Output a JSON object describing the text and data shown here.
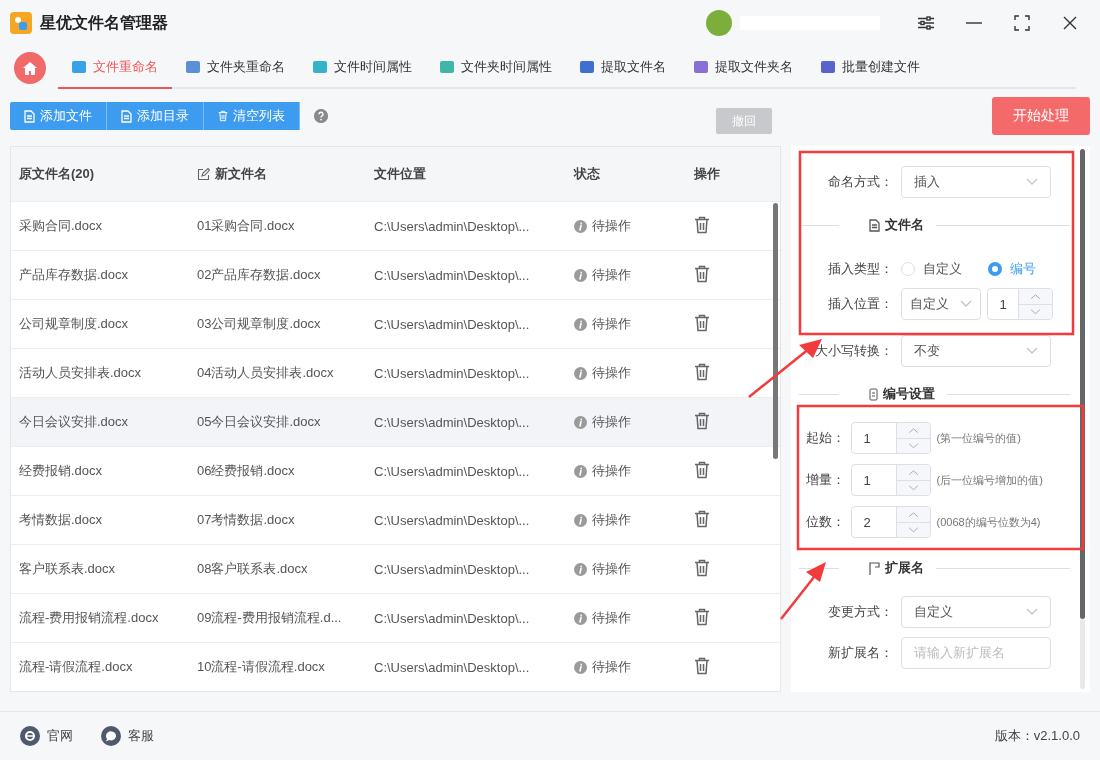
{
  "app": {
    "title": "星优文件名管理器"
  },
  "tabs": [
    {
      "label": "文件重命名",
      "selected": true,
      "color": "#3aa0e8"
    },
    {
      "label": "文件夹重命名",
      "selected": false,
      "color": "#5b8fd6"
    },
    {
      "label": "文件时间属性",
      "selected": false,
      "color": "#36b3c9"
    },
    {
      "label": "文件夹时间属性",
      "selected": false,
      "color": "#40b6a8"
    },
    {
      "label": "提取文件名",
      "selected": false,
      "color": "#3f6fd0"
    },
    {
      "label": "提取文件夹名",
      "selected": false,
      "color": "#8a6fd8"
    },
    {
      "label": "批量创建文件",
      "selected": false,
      "color": "#5a63c9"
    }
  ],
  "toolbar": {
    "buttons": [
      {
        "label": "添加文件",
        "kind": "doc"
      },
      {
        "label": "添加目录",
        "kind": "doc"
      },
      {
        "label": "清空列表",
        "kind": "trash"
      }
    ],
    "undo": {
      "label": "撤回",
      "disabled": true
    },
    "start": "开始处理"
  },
  "table": {
    "columns": [
      "原文件名(20)",
      "新文件名",
      "文件位置",
      "状态",
      "操作"
    ],
    "rows": [
      {
        "original": "采购合同.docx",
        "renamed": "01采购合同.docx",
        "location": "C:\\Users\\admin\\Desktop\\...",
        "status": "待操作",
        "selected": false
      },
      {
        "original": "产品库存数据.docx",
        "renamed": "02产品库存数据.docx",
        "location": "C:\\Users\\admin\\Desktop\\...",
        "status": "待操作",
        "selected": false
      },
      {
        "original": "公司规章制度.docx",
        "renamed": "03公司规章制度.docx",
        "location": "C:\\Users\\admin\\Desktop\\...",
        "status": "待操作",
        "selected": false
      },
      {
        "original": "活动人员安排表.docx",
        "renamed": "04活动人员安排表.docx",
        "location": "C:\\Users\\admin\\Desktop\\...",
        "status": "待操作",
        "selected": false
      },
      {
        "original": "今日会议安排.docx",
        "renamed": "05今日会议安排.docx",
        "location": "C:\\Users\\admin\\Desktop\\...",
        "status": "待操作",
        "selected": true
      },
      {
        "original": "经费报销.docx",
        "renamed": "06经费报销.docx",
        "location": "C:\\Users\\admin\\Desktop\\...",
        "status": "待操作",
        "selected": false
      },
      {
        "original": "考情数据.docx",
        "renamed": "07考情数据.docx",
        "location": "C:\\Users\\admin\\Desktop\\...",
        "status": "待操作",
        "selected": false
      },
      {
        "original": "客户联系表.docx",
        "renamed": "08客户联系表.docx",
        "location": "C:\\Users\\admin\\Desktop\\...",
        "status": "待操作",
        "selected": false
      },
      {
        "original": "流程-费用报销流程.docx",
        "renamed": "09流程-费用报销流程.d...",
        "location": "C:\\Users\\admin\\Desktop\\...",
        "status": "待操作",
        "selected": false
      },
      {
        "original": "流程-请假流程.docx",
        "renamed": "10流程-请假流程.docx",
        "location": "C:\\Users\\admin\\Desktop\\...",
        "status": "待操作",
        "selected": false
      }
    ]
  },
  "panel": {
    "naming": {
      "label": "命名方式：",
      "value": "插入"
    },
    "filename_section": "文件名",
    "insert_type": {
      "label": "插入类型：",
      "options": [
        {
          "label": "自定义",
          "selected": false
        },
        {
          "label": "编号",
          "selected": true
        }
      ]
    },
    "insert_position": {
      "label": "插入位置：",
      "mode": "自定义",
      "value": "1"
    },
    "case": {
      "label": "大小写转换：",
      "value": "不变"
    },
    "numbering_section": "编号设置",
    "numbering": [
      {
        "label": "起始：",
        "value": "1",
        "hint": "(第一位编号的值)"
      },
      {
        "label": "增量：",
        "value": "1",
        "hint": "(后一位编号增加的值)"
      },
      {
        "label": "位数：",
        "value": "2",
        "hint": "(0068的编号位数为4)"
      }
    ],
    "extension_section": "扩展名",
    "ext_mode": {
      "label": "变更方式：",
      "value": "自定义"
    },
    "new_ext": {
      "label": "新扩展名：",
      "placeholder": "请输入新扩展名"
    }
  },
  "footer": {
    "links": [
      {
        "label": "官网",
        "kind": "web"
      },
      {
        "label": "客服",
        "kind": "chat"
      }
    ],
    "version": "版本：v2.1.0.0"
  }
}
